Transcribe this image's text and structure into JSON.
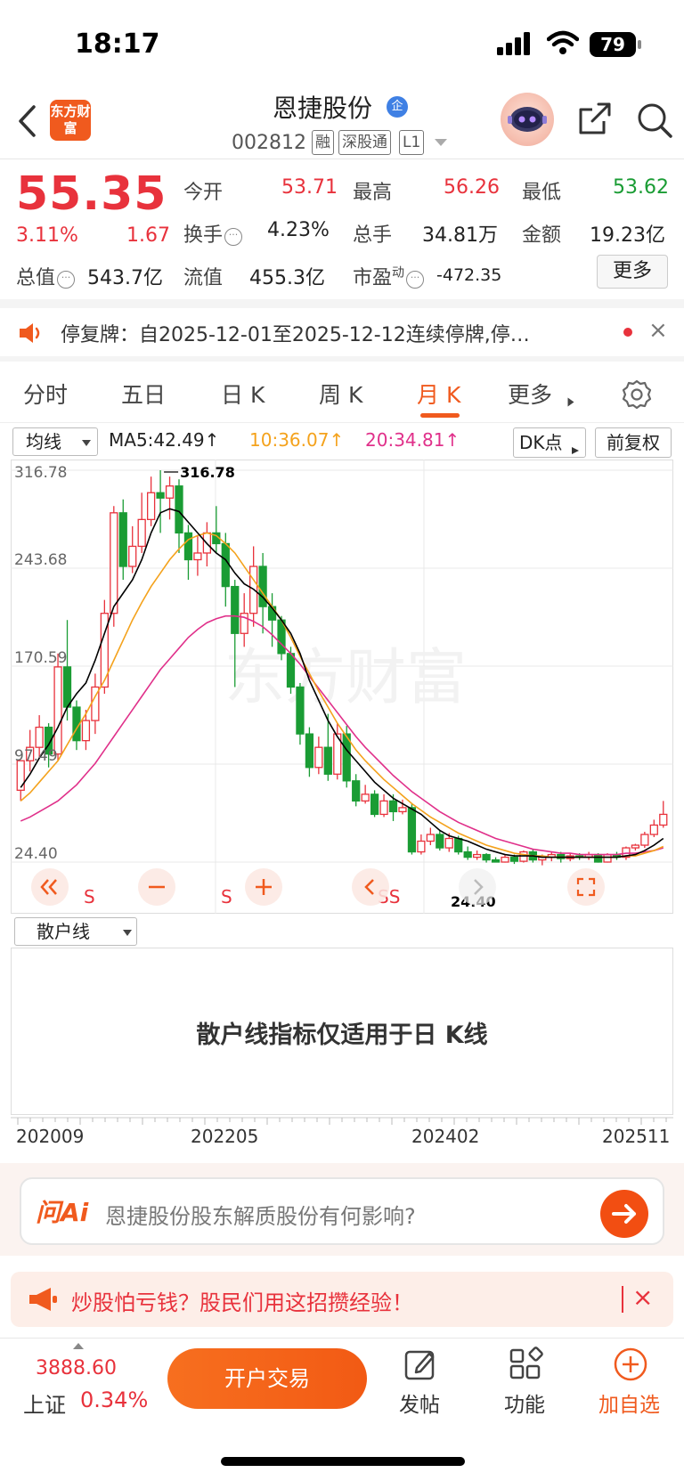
{
  "status_bar": {
    "time": "18:17",
    "battery": "79"
  },
  "header": {
    "app_logo_text": "东方财富",
    "stock_name": "恩捷股份",
    "stock_badge": "企",
    "stock_code": "002812",
    "tags": [
      "融",
      "深股通",
      "L1"
    ]
  },
  "quote": {
    "price": "55.35",
    "change_pct": "3.11%",
    "change_amt": "1.67",
    "rows": [
      [
        {
          "label": "今开",
          "value": "53.71",
          "color": "#e8323c"
        },
        {
          "label": "最高",
          "value": "56.26",
          "color": "#e8323c"
        },
        {
          "label": "最低",
          "value": "53.62",
          "color": "#1a9c34"
        }
      ],
      [
        {
          "label": "换手",
          "value": "4.23%",
          "color": "#222222"
        },
        {
          "label": "总手",
          "value": "34.81万",
          "color": "#222222"
        },
        {
          "label": "金额",
          "value": "19.23亿",
          "color": "#222222"
        }
      ]
    ],
    "total_value_label": "总值",
    "total_value": "543.7亿",
    "float_value_label": "流值",
    "float_value": "455.3亿",
    "pe_label": "市盈",
    "pe_superscript": "动",
    "pe_value": "-472.35",
    "more_label": "更多"
  },
  "notice": {
    "text": "停复牌：自2025-12-01至2025-12-12连续停牌,停…",
    "close": "×"
  },
  "tabs": [
    "分时",
    "五日",
    "日 K",
    "周 K",
    "月 K",
    "更多"
  ],
  "active_tab": "月 K",
  "indicator_bar": {
    "ma_select": "均线",
    "ma5": "MA5:42.49↑",
    "ma10": "10:36.07↑",
    "ma20": "20:34.81↑",
    "ma5_color": "#000000",
    "ma10_color": "#f4a21c",
    "ma20_color": "#e0308a",
    "dk_button": "DK点",
    "adjust_button": "前复权"
  },
  "chart_data": {
    "type": "candlestick",
    "period": "monthly",
    "y_ticks": [
      "316.78",
      "243.68",
      "170.59",
      "97.49",
      "24.40"
    ],
    "ylim": [
      24.4,
      316.78
    ],
    "max_label": "316.78",
    "min_label": "24.40",
    "x_ticks": [
      "202009",
      "202205",
      "202402",
      "202511"
    ],
    "signal_labels": [
      "S",
      "S",
      "SS"
    ],
    "up_color": "#e8323c",
    "down_color": "#1a9c34",
    "candles": [
      [
        78,
        100,
        78,
        70
      ],
      [
        100,
        110,
        123,
        92
      ],
      [
        110,
        125,
        134,
        102
      ],
      [
        125,
        105,
        128,
        95
      ],
      [
        105,
        170,
        180,
        100
      ],
      [
        170,
        140,
        205,
        130
      ],
      [
        140,
        115,
        145,
        108
      ],
      [
        115,
        130,
        138,
        108
      ],
      [
        130,
        155,
        165,
        120
      ],
      [
        155,
        210,
        220,
        150
      ],
      [
        210,
        285,
        290,
        200
      ],
      [
        285,
        245,
        295,
        235
      ],
      [
        245,
        260,
        275,
        240
      ],
      [
        260,
        280,
        300,
        255
      ],
      [
        280,
        300,
        312,
        275
      ],
      [
        300,
        296,
        316.78,
        270
      ],
      [
        296,
        305,
        312,
        280
      ],
      [
        305,
        270,
        310,
        255
      ],
      [
        270,
        250,
        276,
        235
      ],
      [
        250,
        255,
        268,
        238
      ],
      [
        255,
        270,
        278,
        245
      ],
      [
        270,
        262,
        290,
        255
      ],
      [
        262,
        230,
        270,
        215
      ],
      [
        230,
        195,
        235,
        155
      ],
      [
        195,
        210,
        225,
        185
      ],
      [
        210,
        245,
        260,
        200
      ],
      [
        245,
        215,
        255,
        195
      ],
      [
        215,
        205,
        225,
        185
      ],
      [
        205,
        180,
        208,
        175
      ],
      [
        180,
        155,
        185,
        150
      ],
      [
        155,
        120,
        158,
        112
      ],
      [
        120,
        95,
        125,
        88
      ],
      [
        95,
        110,
        118,
        90
      ],
      [
        110,
        90,
        135,
        85
      ],
      [
        90,
        120,
        128,
        86
      ],
      [
        120,
        85,
        126,
        80
      ],
      [
        85,
        70,
        90,
        66
      ],
      [
        70,
        75,
        82,
        68
      ],
      [
        75,
        60,
        78,
        58
      ],
      [
        60,
        70,
        75,
        58
      ],
      [
        70,
        62,
        75,
        55
      ],
      [
        62,
        65,
        71,
        60
      ],
      [
        65,
        32,
        68,
        30
      ],
      [
        32,
        40,
        45,
        30
      ],
      [
        40,
        45,
        50,
        37
      ],
      [
        45,
        35,
        48,
        33
      ],
      [
        35,
        42,
        46,
        32
      ],
      [
        42,
        32,
        44,
        30
      ],
      [
        32,
        28,
        36,
        26
      ],
      [
        28,
        30,
        33,
        26
      ],
      [
        30,
        26,
        31,
        24
      ],
      [
        26,
        24.4,
        28,
        24.4
      ],
      [
        24.4,
        28,
        30,
        24
      ],
      [
        28,
        25,
        30,
        23
      ],
      [
        25,
        32,
        33,
        24
      ],
      [
        32,
        26,
        34,
        24
      ],
      [
        26,
        28,
        30,
        22
      ],
      [
        28,
        30,
        32,
        25
      ],
      [
        30,
        27,
        32,
        24
      ],
      [
        27,
        29,
        31,
        25
      ],
      [
        29,
        28,
        31,
        26
      ],
      [
        28,
        30,
        32,
        26
      ],
      [
        30,
        24.4,
        31,
        24
      ],
      [
        24.4,
        30,
        31,
        24
      ],
      [
        30,
        28,
        32,
        26
      ],
      [
        28,
        35,
        36,
        26
      ],
      [
        35,
        37,
        38,
        33
      ],
      [
        37,
        45,
        47,
        35
      ],
      [
        45,
        52,
        56,
        43
      ],
      [
        52,
        60,
        70,
        50
      ]
    ],
    "ma5": [
      80,
      90,
      102,
      112,
      125,
      140,
      150,
      158,
      175,
      195,
      215,
      225,
      235,
      250,
      270,
      285,
      288,
      286,
      278,
      270,
      262,
      255,
      250,
      240,
      232,
      228,
      222,
      214,
      205,
      195,
      180,
      160,
      145,
      130,
      118,
      108,
      100,
      92,
      84,
      78,
      72,
      68,
      64,
      60,
      54,
      48,
      44,
      42,
      40,
      37,
      34,
      32,
      30,
      29,
      29,
      29,
      28,
      28,
      28,
      28,
      28,
      28,
      28,
      28,
      28,
      29,
      30,
      33,
      37,
      42
    ],
    "ma10": [
      70,
      76,
      84,
      92,
      100,
      112,
      124,
      135,
      148,
      160,
      175,
      190,
      205,
      218,
      230,
      240,
      250,
      258,
      265,
      268,
      270,
      268,
      262,
      255,
      245,
      235,
      225,
      215,
      205,
      192,
      178,
      165,
      152,
      140,
      128,
      118,
      108,
      100,
      93,
      86,
      80,
      74,
      68,
      63,
      58,
      54,
      50,
      46,
      43,
      40,
      37,
      35,
      33,
      31,
      30,
      29,
      29,
      28,
      28,
      28,
      28,
      28,
      28,
      28,
      28,
      29,
      29,
      31,
      33,
      36
    ],
    "ma20": [
      55,
      58,
      62,
      66,
      70,
      76,
      82,
      90,
      98,
      108,
      118,
      128,
      138,
      148,
      158,
      168,
      176,
      184,
      192,
      198,
      203,
      206,
      208,
      208,
      207,
      204,
      200,
      194,
      187,
      180,
      172,
      163,
      154,
      145,
      136,
      127,
      118,
      110,
      103,
      96,
      89,
      83,
      77,
      72,
      67,
      62,
      58,
      54,
      51,
      48,
      45,
      42,
      40,
      38,
      36,
      34,
      33,
      32,
      31,
      31,
      30,
      30,
      30,
      30,
      30,
      31,
      31,
      32,
      33,
      35
    ]
  },
  "retail": {
    "select": "散户线",
    "message": "散户线指标仅适用于日 K线"
  },
  "ai_bar": {
    "logo": "问Ai",
    "prompt": "恩捷股份股东解质股份有何影响?"
  },
  "promo": {
    "text": "炒股怕亏钱？股民们用这招攒经验！",
    "close": "×"
  },
  "bottom_bar": {
    "index_value": "3888.60",
    "index_name": "上证",
    "index_pct": "0.34%",
    "trade_button": "开户交易",
    "nav": [
      "发帖",
      "功能",
      "加自选"
    ]
  }
}
